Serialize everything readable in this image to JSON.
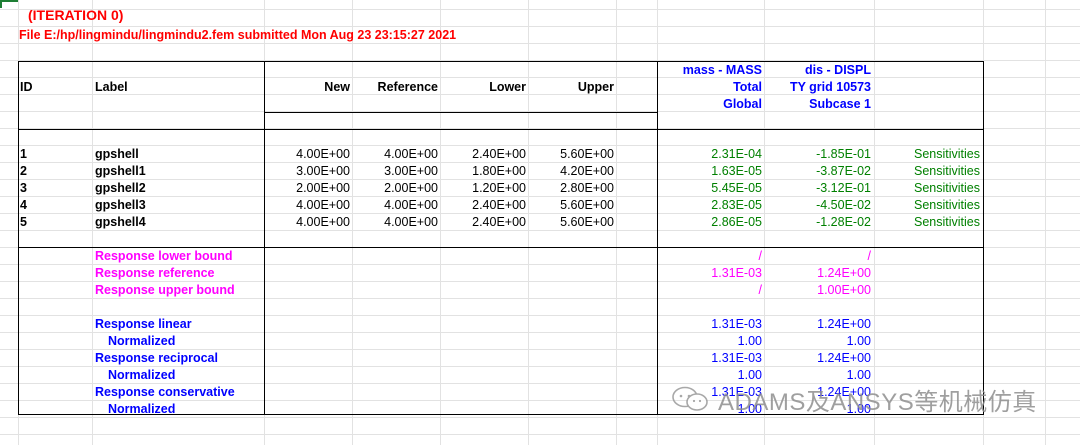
{
  "header": {
    "iteration": "(ITERATION 0)",
    "file_line": "File E:/hp/lingmindu/lingmindu2.fem submitted Mon Aug 23 23:15:27 2021"
  },
  "columns": {
    "id": "ID",
    "label": "Label",
    "new": "New",
    "reference": "Reference",
    "lower": "Lower",
    "upper": "Upper",
    "mass": [
      "mass - MASS",
      "Total",
      "Global"
    ],
    "disp": [
      "dis - DISPL",
      "TY grid 10573",
      "Subcase 1"
    ]
  },
  "rows": [
    {
      "id": "1",
      "label": "gpshell",
      "new": "4.00E+00",
      "reference": "4.00E+00",
      "lower": "2.40E+00",
      "upper": "5.60E+00",
      "mass": "2.31E-04",
      "disp": "-1.85E-01",
      "note": "Sensitivities"
    },
    {
      "id": "2",
      "label": "gpshell1",
      "new": "3.00E+00",
      "reference": "3.00E+00",
      "lower": "1.80E+00",
      "upper": "4.20E+00",
      "mass": "1.63E-05",
      "disp": "-3.87E-02",
      "note": "Sensitivities"
    },
    {
      "id": "3",
      "label": "gpshell2",
      "new": "2.00E+00",
      "reference": "2.00E+00",
      "lower": "1.20E+00",
      "upper": "2.80E+00",
      "mass": "5.45E-05",
      "disp": "-3.12E-01",
      "note": "Sensitivities"
    },
    {
      "id": "4",
      "label": "gpshell3",
      "new": "4.00E+00",
      "reference": "4.00E+00",
      "lower": "2.40E+00",
      "upper": "5.60E+00",
      "mass": "2.83E-05",
      "disp": "-4.50E-02",
      "note": "Sensitivities"
    },
    {
      "id": "5",
      "label": "gpshell4",
      "new": "4.00E+00",
      "reference": "4.00E+00",
      "lower": "2.40E+00",
      "upper": "5.60E+00",
      "mass": "2.86E-05",
      "disp": "-1.28E-02",
      "note": "Sensitivities"
    }
  ],
  "responses": [
    {
      "label": "Response lower bound",
      "mass": "/",
      "disp": "/",
      "color": "#ff00ff",
      "indent": false
    },
    {
      "label": "Response reference",
      "mass": "1.31E-03",
      "disp": "1.24E+00",
      "color": "#ff00ff",
      "indent": false
    },
    {
      "label": "Response upper bound",
      "mass": "/",
      "disp": "1.00E+00",
      "color": "#ff00ff",
      "indent": false
    },
    {
      "label": "Response linear",
      "mass": "1.31E-03",
      "disp": "1.24E+00",
      "color": "#0000ff",
      "indent": false
    },
    {
      "label": "Normalized",
      "mass": "1.00",
      "disp": "1.00",
      "color": "#0000ff",
      "indent": true
    },
    {
      "label": "Response reciprocal",
      "mass": "1.31E-03",
      "disp": "1.24E+00",
      "color": "#0000ff",
      "indent": false
    },
    {
      "label": "Normalized",
      "mass": "1.00",
      "disp": "1.00",
      "color": "#0000ff",
      "indent": true
    },
    {
      "label": "Response conservative",
      "mass": "1.31E-03",
      "disp": "1.24E+00",
      "color": "#0000ff",
      "indent": false
    },
    {
      "label": "Normalized",
      "mass": "1.00",
      "disp": "1.00",
      "color": "#0000ff",
      "indent": true
    }
  ],
  "watermark": {
    "text": "ADAMS及ANSYS等机械仿真",
    "icon": "wechat-icon"
  },
  "colors": {
    "title": "#ff0000",
    "sensitivity": "#008000",
    "objective_header": "#0000ff",
    "bounds": "#ff00ff",
    "responses": "#0000ff",
    "grid": "#e2e2e2"
  }
}
